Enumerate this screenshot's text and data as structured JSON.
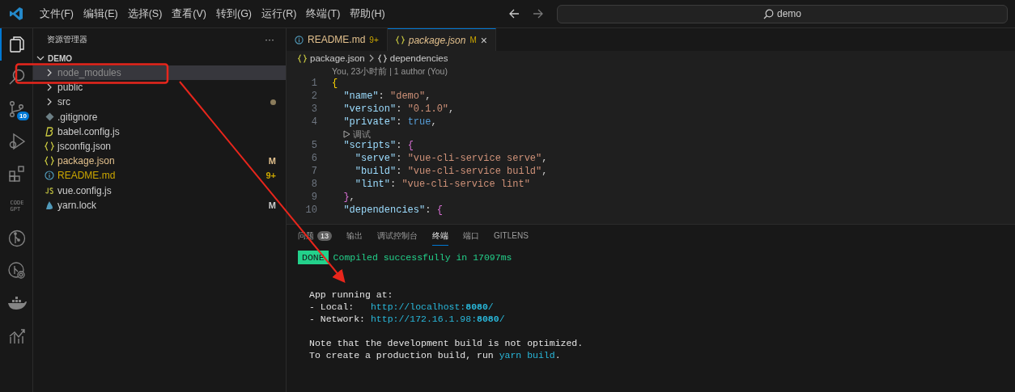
{
  "title_bar": {
    "menu": [
      "文件(F)",
      "编辑(E)",
      "选择(S)",
      "查看(V)",
      "转到(G)",
      "运行(R)",
      "终端(T)",
      "帮助(H)"
    ],
    "search": {
      "value": "demo"
    }
  },
  "activity_bar": [
    {
      "kind": "explorer",
      "selected": true
    },
    {
      "kind": "search",
      "selected": false
    },
    {
      "kind": "source-control",
      "selected": false,
      "badge": "10"
    },
    {
      "kind": "run-debug",
      "selected": false
    },
    {
      "kind": "extensions",
      "selected": false
    },
    {
      "kind": "codegpt",
      "selected": false,
      "label_top": "CODE",
      "label_bottom": "GPT"
    },
    {
      "kind": "git-graph",
      "selected": false
    },
    {
      "kind": "git-inspect",
      "selected": false
    },
    {
      "kind": "docker",
      "selected": false
    },
    {
      "kind": "chart",
      "selected": false
    }
  ],
  "sidebar": {
    "title": "资源管理器",
    "more": "···",
    "root": {
      "label": "DEMO",
      "expanded": true,
      "children": [
        {
          "label": "node_modules",
          "kind": "folder",
          "expanded": false,
          "selected": true,
          "color": "#8c8c8c"
        },
        {
          "label": "public",
          "kind": "folder",
          "expanded": false,
          "selected": false,
          "color": "#cccccc"
        },
        {
          "label": "src",
          "kind": "folder",
          "expanded": false,
          "selected": false,
          "color": "#cccccc",
          "dot": true
        },
        {
          "label": ".gitignore",
          "kind": "gitignore",
          "selected": false,
          "color": "#cccccc"
        },
        {
          "label": "babel.config.js",
          "kind": "babel",
          "selected": false,
          "color": "#cccccc"
        },
        {
          "label": "jsconfig.json",
          "kind": "json",
          "selected": false,
          "color": "#cccccc"
        },
        {
          "label": "package.json",
          "kind": "json",
          "selected": false,
          "color": "#e2c08d",
          "badge": "M"
        },
        {
          "label": "README.md",
          "kind": "info",
          "selected": false,
          "color": "#cca700",
          "badge": "9+"
        },
        {
          "label": "vue.config.js",
          "kind": "js",
          "selected": false,
          "color": "#cccccc"
        },
        {
          "label": "yarn.lock",
          "kind": "yarn",
          "selected": false,
          "color": "#cccccc",
          "badge": "M"
        }
      ]
    }
  },
  "editor": {
    "tabs": [
      {
        "label": "README.md",
        "kind": "info",
        "badge": "9+",
        "selected": false
      },
      {
        "label": "package.json",
        "kind": "json",
        "badge": "M",
        "selected": true,
        "close": "×"
      }
    ],
    "breadcrumb": [
      "package.json",
      "dependencies"
    ],
    "lines": [
      {
        "kind": "codelens",
        "text": "You, 23小时前 | 1 author (You)"
      },
      {
        "kind": "code",
        "number": "1",
        "tokens": [
          {
            "kind": "brace",
            "s": "{"
          }
        ]
      },
      {
        "kind": "code",
        "number": "2",
        "tokens": [
          {
            "kind": "key",
            "s": "  \"name\""
          },
          {
            "kind": "punct",
            "s": ": "
          },
          {
            "kind": "str",
            "s": "\"demo\""
          },
          {
            "kind": "punct",
            "s": ","
          }
        ]
      },
      {
        "kind": "code",
        "number": "3",
        "tokens": [
          {
            "kind": "key",
            "s": "  \"version\""
          },
          {
            "kind": "punct",
            "s": ": "
          },
          {
            "kind": "str",
            "s": "\"0.1.0\""
          },
          {
            "kind": "punct",
            "s": ","
          }
        ]
      },
      {
        "kind": "code",
        "number": "4",
        "tokens": [
          {
            "kind": "key",
            "s": "  \"private\""
          },
          {
            "kind": "punct",
            "s": ": "
          },
          {
            "kind": "bool",
            "s": "true"
          },
          {
            "kind": "punct",
            "s": ","
          }
        ]
      },
      {
        "kind": "debuglens",
        "text": "调试"
      },
      {
        "kind": "code",
        "number": "5",
        "tokens": [
          {
            "kind": "key",
            "s": "  \"scripts\""
          },
          {
            "kind": "punct",
            "s": ": "
          },
          {
            "kind": "brace2",
            "s": "{"
          }
        ]
      },
      {
        "kind": "code",
        "number": "6",
        "tokens": [
          {
            "kind": "key",
            "s": "    \"serve\""
          },
          {
            "kind": "punct",
            "s": ": "
          },
          {
            "kind": "str",
            "s": "\"vue-cli-service serve\""
          },
          {
            "kind": "punct",
            "s": ","
          }
        ]
      },
      {
        "kind": "code",
        "number": "7",
        "tokens": [
          {
            "kind": "key",
            "s": "    \"build\""
          },
          {
            "kind": "punct",
            "s": ": "
          },
          {
            "kind": "str",
            "s": "\"vue-cli-service build\""
          },
          {
            "kind": "punct",
            "s": ","
          }
        ]
      },
      {
        "kind": "code",
        "number": "8",
        "tokens": [
          {
            "kind": "key",
            "s": "    \"lint\""
          },
          {
            "kind": "punct",
            "s": ": "
          },
          {
            "kind": "str",
            "s": "\"vue-cli-service lint\""
          }
        ]
      },
      {
        "kind": "code",
        "number": "9",
        "tokens": [
          {
            "kind": "brace2",
            "s": "  }"
          },
          {
            "kind": "punct",
            "s": ","
          }
        ]
      },
      {
        "kind": "code",
        "number": "10",
        "tokens": [
          {
            "kind": "key",
            "s": "  \"dependencies\""
          },
          {
            "kind": "punct",
            "s": ": "
          },
          {
            "kind": "brace2",
            "s": "{"
          }
        ]
      }
    ]
  },
  "panel": {
    "tabs": [
      {
        "label": "问题",
        "badge": "13",
        "selected": false
      },
      {
        "label": "输出",
        "selected": false
      },
      {
        "label": "调试控制台",
        "selected": false
      },
      {
        "label": "终端",
        "selected": true
      },
      {
        "label": "端口",
        "selected": false
      },
      {
        "label": "GITLENS",
        "selected": false
      }
    ],
    "terminal": [
      {
        "kind": "done",
        "badge": "DONE",
        "segments": [
          {
            "kind": "success",
            "s": "Compiled successfully in 17097ms"
          }
        ]
      },
      {
        "kind": "blank"
      },
      {
        "kind": "blank"
      },
      {
        "kind": "line",
        "segments": [
          {
            "kind": "plain",
            "s": "App running at:"
          }
        ]
      },
      {
        "kind": "line",
        "segments": [
          {
            "kind": "plain",
            "s": "- Local:   "
          },
          {
            "kind": "link",
            "s": "http://localhost:"
          },
          {
            "kind": "linkbold",
            "s": "8080"
          },
          {
            "kind": "link",
            "s": "/"
          }
        ]
      },
      {
        "kind": "line",
        "segments": [
          {
            "kind": "plain",
            "s": "- Network: "
          },
          {
            "kind": "link",
            "s": "http://172.16.1.98:"
          },
          {
            "kind": "linkbold",
            "s": "8080"
          },
          {
            "kind": "link",
            "s": "/"
          }
        ]
      },
      {
        "kind": "blank"
      },
      {
        "kind": "line",
        "segments": [
          {
            "kind": "plain",
            "s": "Note that the development build is not optimized."
          }
        ]
      },
      {
        "kind": "line",
        "segments": [
          {
            "kind": "plain",
            "s": "To create a production build, run "
          },
          {
            "kind": "link",
            "s": "yarn build"
          },
          {
            "kind": "plain",
            "s": "."
          }
        ]
      }
    ]
  }
}
